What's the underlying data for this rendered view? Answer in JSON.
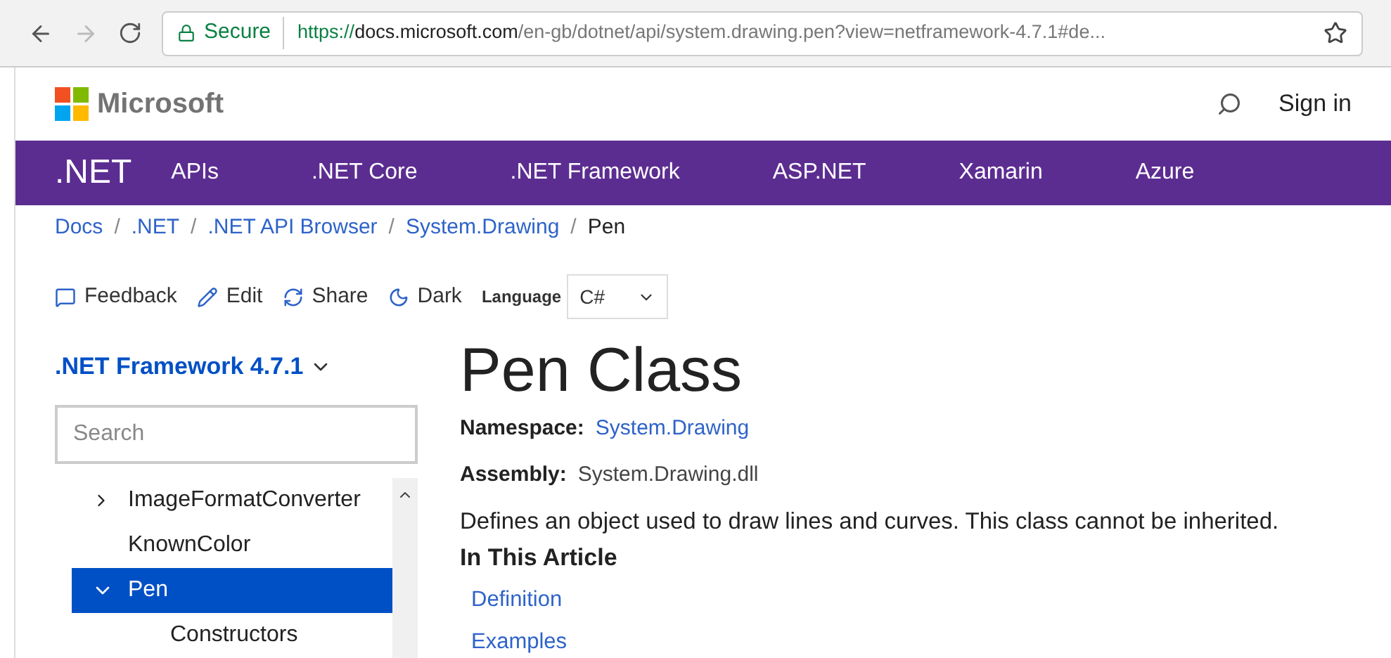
{
  "browser": {
    "secure_label": "Secure",
    "url_scheme": "https://",
    "url_host": "docs.microsoft.com",
    "url_path": "/en-gb/dotnet/api/system.drawing.pen?view=netframework-4.7.1#de..."
  },
  "header": {
    "brand": "Microsoft",
    "sign_in": "Sign in"
  },
  "nav": {
    "product": ".NET",
    "items": [
      "APIs",
      ".NET Core",
      ".NET Framework",
      "ASP.NET",
      "Xamarin",
      "Azure"
    ]
  },
  "breadcrumb": {
    "links": [
      "Docs",
      ".NET",
      ".NET API Browser",
      "System.Drawing"
    ],
    "separator": "/",
    "current": "Pen"
  },
  "toolbar": {
    "actions": [
      {
        "kind": "feedback",
        "label": "Feedback"
      },
      {
        "kind": "edit",
        "label": "Edit"
      },
      {
        "kind": "share",
        "label": "Share"
      },
      {
        "kind": "dark",
        "label": "Dark"
      }
    ],
    "language_label": "Language",
    "language_value": "C#"
  },
  "sidebar": {
    "version": ".NET Framework 4.7.1",
    "search": {
      "placeholder": "Search"
    },
    "tree": [
      {
        "label": "ImageFormatConverter",
        "expanded": false,
        "selected": false,
        "has_children": true
      },
      {
        "label": "KnownColor",
        "expanded": false,
        "selected": false,
        "has_children": false
      },
      {
        "label": "Pen",
        "expanded": true,
        "selected": true,
        "has_children": true,
        "children": [
          {
            "label": "Constructors",
            "expanded": false,
            "selected": false,
            "has_children": false
          }
        ]
      }
    ]
  },
  "article": {
    "title": "Pen Class",
    "namespace_label": "Namespace:",
    "namespace": "System.Drawing",
    "assembly_label": "Assembly:",
    "assembly": "System.Drawing.dll",
    "summary": "Defines an object used to draw lines and curves. This class cannot be inherited.",
    "toc_heading": "In This Article",
    "toc": [
      "Definition",
      "Examples"
    ]
  }
}
